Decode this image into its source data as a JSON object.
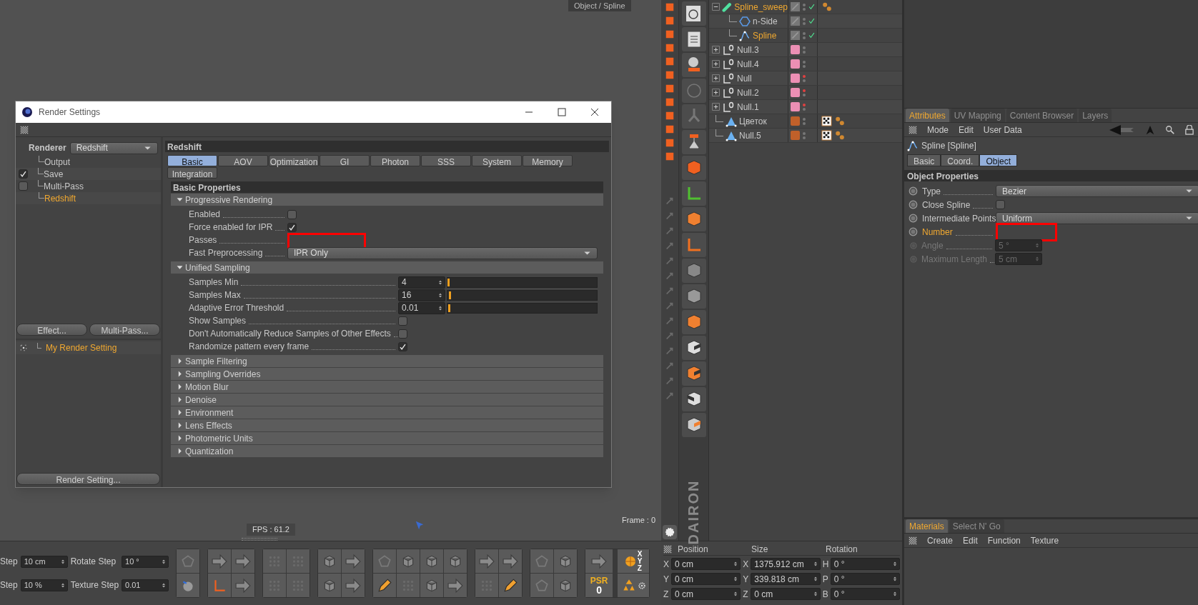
{
  "viewport": {
    "header_text": "Object / Spline",
    "fps": "FPS : 61.2",
    "frame": "Frame : 0"
  },
  "render_settings": {
    "title": "Render Settings",
    "renderer": {
      "label": "Renderer",
      "value": "Redshift"
    },
    "tree": [
      {
        "label": "Output",
        "kind": "plain",
        "selected": false
      },
      {
        "label": "Save",
        "kind": "check",
        "checked": true,
        "selected": false
      },
      {
        "label": "Multi-Pass",
        "kind": "check",
        "checked": false,
        "selected": false
      },
      {
        "label": "Redshift",
        "kind": "plain",
        "selected": true
      }
    ],
    "buttons": [
      "Effect...",
      "Multi-Pass..."
    ],
    "presets": [
      {
        "label": "My Render Setting",
        "selected": true
      }
    ],
    "render_setting_button": "Render Setting...",
    "panel_title": "Redshift",
    "tabs": [
      {
        "label": "Basic",
        "selected": true
      },
      {
        "label": "AOV",
        "selected": false
      },
      {
        "label": "Optimization",
        "selected": false
      },
      {
        "label": "GI",
        "selected": false
      },
      {
        "label": "Photon",
        "selected": false
      },
      {
        "label": "SSS",
        "selected": false
      },
      {
        "label": "System",
        "selected": false
      },
      {
        "label": "Memory",
        "selected": false
      },
      {
        "label": "Integration",
        "selected": false
      }
    ],
    "section_title": "Basic Properties",
    "groups": [
      {
        "title": "Progressive Rendering",
        "expanded": true,
        "params": [
          {
            "kind": "checkbox",
            "label": "Enabled",
            "checked": false
          },
          {
            "kind": "checkbox",
            "label": "Force enabled for IPR",
            "checked": true
          },
          {
            "kind": "masked",
            "label": "Passes"
          },
          {
            "kind": "dropdown",
            "label": "Fast Preprocessing",
            "value": "IPR Only"
          }
        ]
      },
      {
        "title": "Unified Sampling",
        "expanded": true,
        "params": [
          {
            "kind": "slider",
            "label": "Samples Min",
            "value": "4",
            "level": 0.0
          },
          {
            "kind": "slider",
            "label": "Samples Max",
            "value": "16",
            "level": 0.01
          },
          {
            "kind": "slider",
            "label": "Adaptive Error Threshold",
            "value": "0.01",
            "level": 0.005
          },
          {
            "kind": "checkbox",
            "label": "Show Samples",
            "checked": false
          },
          {
            "kind": "checkbox",
            "label": "Don't Automatically Reduce Samples of Other Effects",
            "checked": false
          },
          {
            "kind": "checkbox",
            "label": "Randomize pattern every frame",
            "checked": true
          }
        ]
      },
      {
        "title": "Sample Filtering",
        "expanded": false
      },
      {
        "title": "Sampling Overrides",
        "expanded": false
      },
      {
        "title": "Motion Blur",
        "expanded": false
      },
      {
        "title": "Denoise",
        "expanded": false
      },
      {
        "title": "Environment",
        "expanded": false
      },
      {
        "title": "Lens Effects",
        "expanded": false
      },
      {
        "title": "Photometric Units",
        "expanded": false
      },
      {
        "title": "Quantization",
        "expanded": false
      }
    ]
  },
  "toolbar": {
    "fields": [
      {
        "label": "Step",
        "value": "10 cm"
      },
      {
        "label": "Rotate Step",
        "value": "10 °"
      },
      {
        "label": "Step",
        "value": "10 %"
      },
      {
        "label": "Texture Step",
        "value": "0.01"
      }
    ],
    "psr_label": "PSR",
    "psr_value": "0",
    "axis_labels": [
      "X",
      "Y",
      "Z"
    ]
  },
  "side_logo": "DAIRON",
  "objects": [
    {
      "name": "Spline_sweep",
      "selected": true,
      "expanded": true,
      "enabled": true,
      "editor_hidden": false,
      "children": [
        {
          "name": "n-Side",
          "selected": false,
          "enabled": true,
          "editor_hidden": false
        },
        {
          "name": "Spline",
          "selected": true,
          "enabled": true,
          "editor_hidden": false
        }
      ]
    },
    {
      "name": "Null.3",
      "selected": false,
      "expanded": false,
      "color": "#ec8fb4",
      "enabled": false,
      "editor_hidden": false
    },
    {
      "name": "Null.4",
      "selected": false,
      "expanded": false,
      "color": "#ec8fb4",
      "enabled": false,
      "editor_hidden": false
    },
    {
      "name": "Null",
      "selected": false,
      "expanded": false,
      "color": "#ec8fb4",
      "enabled": false,
      "editor_hidden": true
    },
    {
      "name": "Null.2",
      "selected": false,
      "expanded": false,
      "color": "#ec8fb4",
      "enabled": false,
      "editor_hidden": true
    },
    {
      "name": "Null.1",
      "selected": false,
      "expanded": false,
      "color": "#ec8fb4",
      "enabled": false,
      "editor_hidden": true
    },
    {
      "name": "Цветок",
      "selected": false,
      "color": "#c0602a",
      "enabled": false,
      "editor_hidden": false
    },
    {
      "name": "Null.5",
      "selected": false,
      "color": "#c0602a",
      "enabled": false,
      "editor_hidden": false
    }
  ],
  "coordinates": {
    "headers": [
      "Position",
      "Size",
      "Rotation"
    ],
    "rows": [
      [
        {
          "axis": "X",
          "value": "0 cm"
        },
        {
          "axis": "X",
          "value": "1375.912 cm"
        },
        {
          "axis": "H",
          "value": "0 °"
        }
      ],
      [
        {
          "axis": "Y",
          "value": "0 cm"
        },
        {
          "axis": "Y",
          "value": "339.818 cm"
        },
        {
          "axis": "P",
          "value": "0 °"
        }
      ],
      [
        {
          "axis": "Z",
          "value": "0 cm"
        },
        {
          "axis": "Z",
          "value": "0 cm"
        },
        {
          "axis": "B",
          "value": "0 °"
        }
      ]
    ]
  },
  "attributes": {
    "tabs": [
      {
        "label": "Attributes",
        "selected": true
      },
      {
        "label": "UV Mapping",
        "selected": false
      },
      {
        "label": "Content Browser",
        "selected": false
      },
      {
        "label": "Layers",
        "selected": false
      }
    ],
    "menu": [
      "Mode",
      "Edit",
      "User Data"
    ],
    "object_title": "Spline [Spline]",
    "subtabs": [
      {
        "label": "Basic",
        "selected": false
      },
      {
        "label": "Coord.",
        "selected": false
      },
      {
        "label": "Object",
        "selected": true
      }
    ],
    "section_title": "Object Properties",
    "params": [
      {
        "kind": "dropdown",
        "label": "Type",
        "value": "Bezier",
        "highlighted": false,
        "disabled": false
      },
      {
        "kind": "checkbox",
        "label": "Close Spline",
        "checked": false,
        "highlighted": false,
        "disabled": false
      },
      {
        "kind": "dropdown",
        "label": "Intermediate Points",
        "value": "Uniform",
        "highlighted": false,
        "disabled": false
      },
      {
        "kind": "masked",
        "label": "Number",
        "highlighted": true,
        "disabled": false
      },
      {
        "kind": "number",
        "label": "Angle",
        "value": "5 °",
        "highlighted": false,
        "disabled": true
      },
      {
        "kind": "number",
        "label": "Maximum Length",
        "value": "5 cm",
        "highlighted": false,
        "disabled": true
      }
    ]
  },
  "materials": {
    "tabs": [
      {
        "label": "Materials",
        "selected": true
      },
      {
        "label": "Select N' Go",
        "selected": false
      }
    ],
    "menu": [
      "Create",
      "Edit",
      "Function",
      "Texture"
    ]
  }
}
